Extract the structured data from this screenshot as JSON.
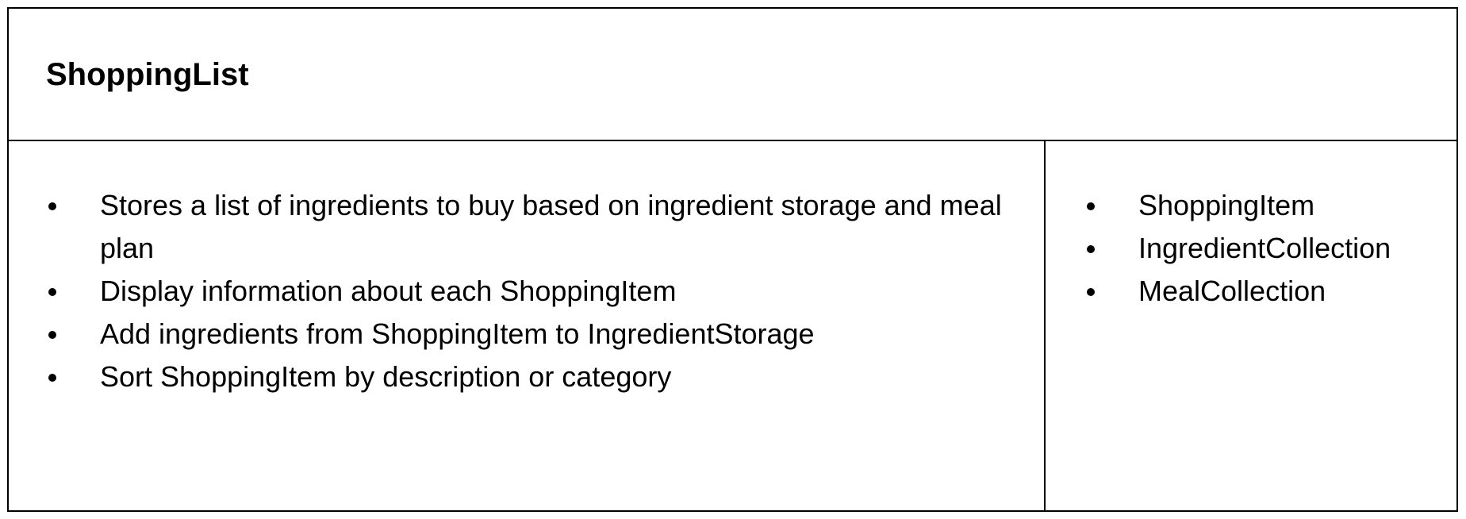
{
  "card": {
    "class_name": "ShoppingList",
    "responsibilities": [
      "Stores a list of ingredients to buy based on ingredient storage and meal plan",
      "Display information about each ShoppingItem",
      "Add ingredients from ShoppingItem to IngredientStorage",
      "Sort ShoppingItem by description or category"
    ],
    "collaborators": [
      "ShoppingItem",
      "IngredientCollection",
      "MealCollection"
    ]
  }
}
